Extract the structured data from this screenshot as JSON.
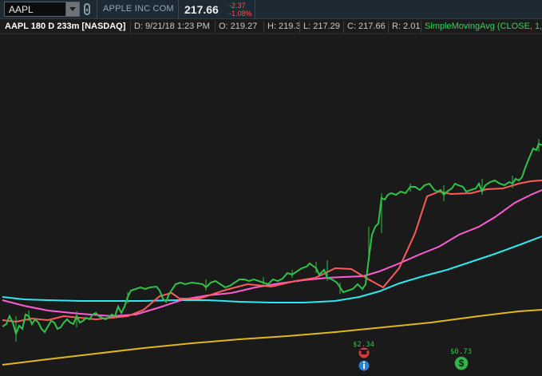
{
  "symbol_field": {
    "value": "AAPL"
  },
  "quote": {
    "company": "APPLE INC COM",
    "last": "217.66",
    "change": "-2.37",
    "change_pct": "-1.08%"
  },
  "chart_header": {
    "title": "AAPL 180 D 233m [NASDAQ]",
    "date": "D: 9/21/18 1:23 PM",
    "open": "O: 219.27",
    "high": "H: 219.3",
    "low": "L: 217.29",
    "close": "C: 217.66",
    "range": "R: 2.01",
    "study": "SimpleMovingAvg (CLOSE, 1,"
  },
  "colors": {
    "background": "#1a1a1a",
    "price_line": "#2fc148",
    "sma_red": "#ff5a5a",
    "sma_magenta": "#ff5cd6",
    "sma_cyan": "#2ee8f0",
    "sma_gold": "#e0b81c"
  },
  "markers": [
    {
      "type": "earnings",
      "icon": "phone-icon",
      "label": "$2.34",
      "secondary_icon": "info-icon"
    },
    {
      "type": "dividend",
      "icon": "dollar-icon",
      "label": "$0.73"
    }
  ]
}
